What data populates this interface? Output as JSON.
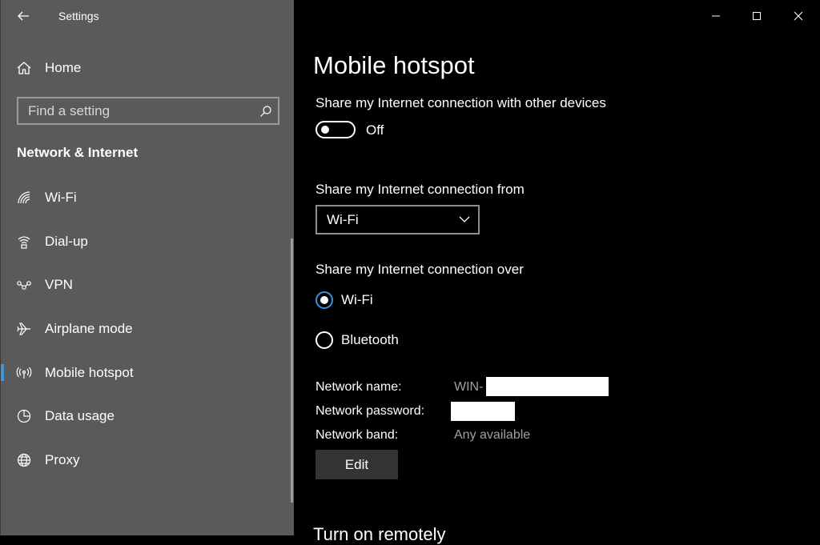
{
  "window": {
    "app_title": "Settings"
  },
  "sidebar": {
    "home_label": "Home",
    "search_placeholder": "Find a setting",
    "section_title": "Network & Internet",
    "items": [
      {
        "label": "Wi-Fi",
        "icon": "wifi-icon"
      },
      {
        "label": "Dial-up",
        "icon": "dialup-icon"
      },
      {
        "label": "VPN",
        "icon": "vpn-icon"
      },
      {
        "label": "Airplane mode",
        "icon": "airplane-icon"
      },
      {
        "label": "Mobile hotspot",
        "icon": "hotspot-icon",
        "selected": true
      },
      {
        "label": "Data usage",
        "icon": "data-usage-icon"
      },
      {
        "label": "Proxy",
        "icon": "globe-icon"
      }
    ]
  },
  "main": {
    "title": "Mobile hotspot",
    "share_label": "Share my Internet connection with other devices",
    "toggle_state": "Off",
    "from_label": "Share my Internet connection from",
    "from_value": "Wi-Fi",
    "over_label": "Share my Internet connection over",
    "over_options": [
      {
        "label": "Wi-Fi",
        "checked": true
      },
      {
        "label": "Bluetooth",
        "checked": false
      }
    ],
    "network_name_label": "Network name:",
    "network_name_value": "WIN-",
    "network_password_label": "Network password:",
    "network_band_label": "Network band:",
    "network_band_value": "Any available",
    "edit_label": "Edit",
    "next_heading": "Turn on remotely"
  },
  "colors": {
    "sidebar_bg": "#5a5a5a",
    "main_bg": "#000000",
    "accent": "#3a96dd"
  }
}
